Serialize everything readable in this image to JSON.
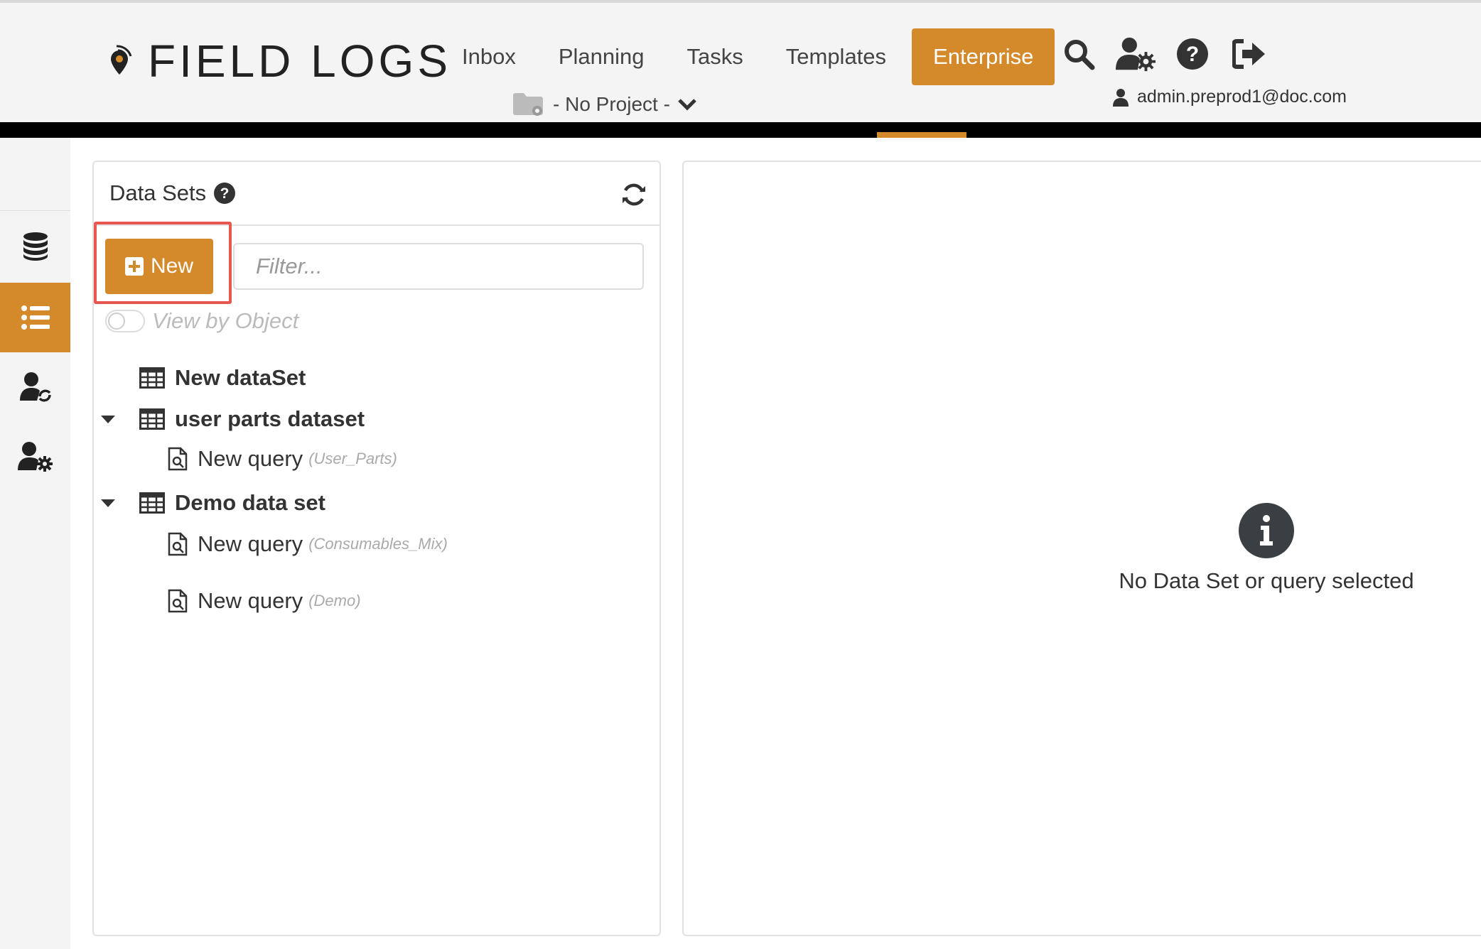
{
  "app": {
    "logo_text": "FIELD LOGS"
  },
  "nav": {
    "items": [
      {
        "label": "Inbox"
      },
      {
        "label": "Planning"
      },
      {
        "label": "Tasks"
      },
      {
        "label": "Templates"
      },
      {
        "label": "Enterprise",
        "active": true
      }
    ]
  },
  "header_icons": [
    "search-icon",
    "user-settings-icon",
    "help-icon",
    "logout-icon"
  ],
  "project": {
    "label": "- No Project -"
  },
  "user": {
    "email": "admin.preprod1@doc.com"
  },
  "sidebar": {
    "items": [
      {
        "icon": "database-icon"
      },
      {
        "icon": "list-icon",
        "active": true
      },
      {
        "icon": "user-sync-icon"
      },
      {
        "icon": "user-settings-icon"
      }
    ]
  },
  "datasets_panel": {
    "title": "Data Sets",
    "new_label": "New",
    "filter_placeholder": "Filter...",
    "toggle_label": "View by Object",
    "tree": [
      {
        "label": "New dataSet",
        "queries": []
      },
      {
        "label": "user parts dataset",
        "expanded": true,
        "queries": [
          {
            "label": "New query",
            "object": "(User_Parts)"
          }
        ]
      },
      {
        "label": "Demo data set",
        "expanded": true,
        "queries": [
          {
            "label": "New query",
            "object": "(Consumables_Mix)"
          },
          {
            "label": "New query",
            "object": "(Demo)"
          }
        ]
      }
    ]
  },
  "detail_panel": {
    "empty_message": "No Data Set or query selected"
  },
  "colors": {
    "accent": "#d48a2a",
    "highlight": "#e8574f",
    "dark": "#3a3f44"
  }
}
